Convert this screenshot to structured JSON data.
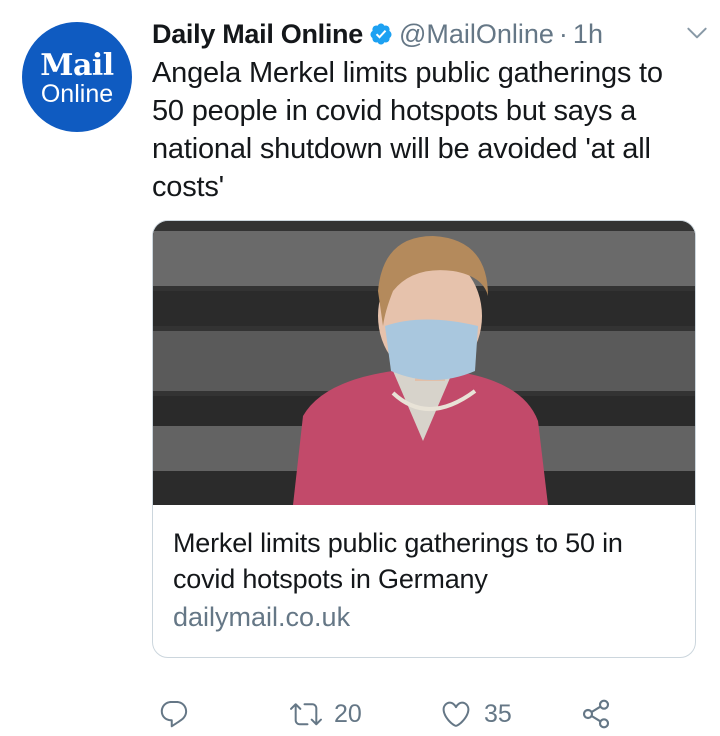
{
  "avatar": {
    "logo_top": "Mail",
    "logo_bottom": "Online",
    "color": "#0f5bc1"
  },
  "tweet": {
    "display_name": "Daily Mail Online",
    "handle": "@MailOnline",
    "separator": "·",
    "time": "1h",
    "text": "Angela Merkel limits public gatherings to 50 people in covid hotspots but says a national shutdown will be avoided 'at all costs'"
  },
  "card": {
    "title": "Merkel limits public gatherings to 50 in covid hotspots in Germany",
    "domain": "dailymail.co.uk"
  },
  "actions": {
    "reply_count": "",
    "retweet_count": "20",
    "like_count": "35"
  },
  "colors": {
    "verified": "#1da1f2",
    "muted": "#657786",
    "text": "#14171a"
  }
}
